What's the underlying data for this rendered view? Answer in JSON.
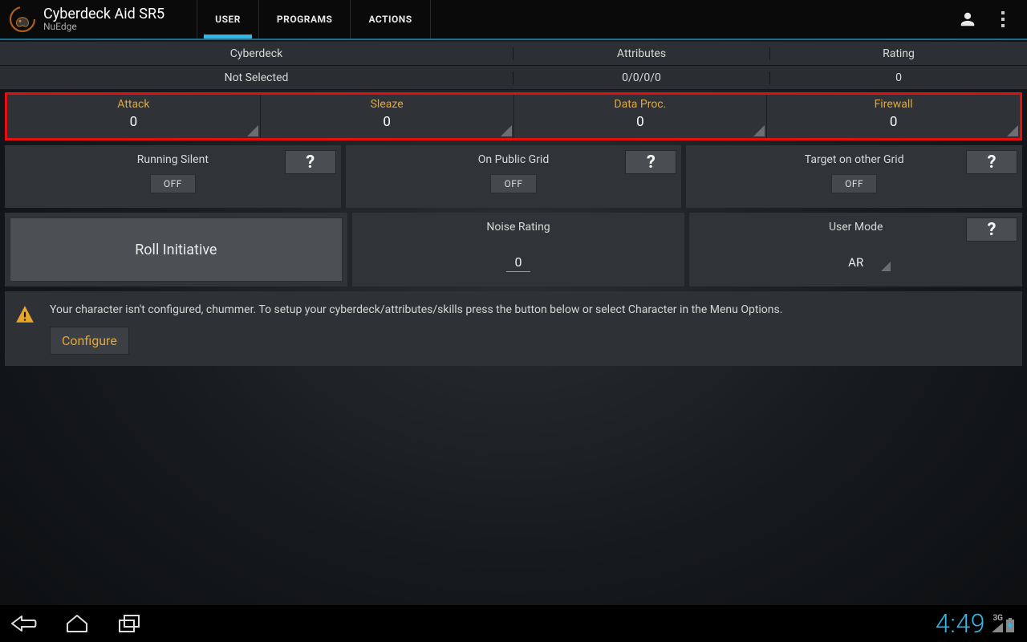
{
  "app": {
    "title": "Cyberdeck Aid SR5",
    "subtitle": "NuEdge"
  },
  "tabs": {
    "user": "USER",
    "programs": "PROGRAMS",
    "actions": "ACTIONS"
  },
  "header": {
    "cols": {
      "cyberdeck": "Cyberdeck",
      "attributes": "Attributes",
      "rating": "Rating"
    },
    "vals": {
      "cyberdeck": "Not Selected",
      "attributes": "0/0/0/0",
      "rating": "0"
    }
  },
  "stats": {
    "attack": {
      "label": "Attack",
      "value": "0"
    },
    "sleaze": {
      "label": "Sleaze",
      "value": "0"
    },
    "dataproc": {
      "label": "Data Proc.",
      "value": "0"
    },
    "firewall": {
      "label": "Firewall",
      "value": "0"
    }
  },
  "toggles": {
    "silent": {
      "label": "Running Silent",
      "state": "OFF"
    },
    "publicgrid": {
      "label": "On Public Grid",
      "state": "OFF"
    },
    "othergrid": {
      "label": "Target on other Grid",
      "state": "OFF"
    }
  },
  "roll": "Roll Initiative",
  "noise": {
    "label": "Noise Rating",
    "value": "0"
  },
  "usermode": {
    "label": "User Mode",
    "value": "AR"
  },
  "help": "?",
  "notice": {
    "text": "Your character isn't configured, chummer. To setup your cyberdeck/attributes/skills press the button below or select Character in the Menu Options.",
    "button": "Configure"
  },
  "statusbar": {
    "time": "4:49",
    "net": "3G"
  }
}
